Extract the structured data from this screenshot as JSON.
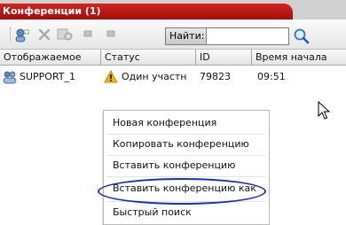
{
  "window": {
    "title": "Конференции (1)"
  },
  "toolbar": {
    "buttons": [
      {
        "name": "new-conference",
        "icon": "people-add-icon"
      },
      {
        "name": "delete",
        "icon": "delete-x-icon"
      },
      {
        "name": "properties",
        "icon": "settings-icon"
      },
      {
        "name": "start",
        "icon": "start-icon"
      },
      {
        "name": "stop",
        "icon": "stop-icon"
      }
    ],
    "find_label": "Найти:",
    "find_value": "",
    "search_icon": "magnifier-icon"
  },
  "table": {
    "columns": [
      "Отображаемое",
      "Статус",
      "ID",
      "Время начала"
    ],
    "rows": [
      {
        "display_name": "SUPPORT_1",
        "status": "Один участн",
        "status_icon": "warning-icon",
        "id": "79823",
        "start_time": "09:51"
      }
    ]
  },
  "context_menu": {
    "items": [
      "Новая конференция",
      "Копировать конференцию",
      "Вставить конференцию",
      "Вставить конференцию как",
      "Быстрый поиск"
    ],
    "highlighted_index": 3
  },
  "colors": {
    "title_bar": "#c21a15",
    "highlight_ellipse": "#1d2bc7",
    "warning": "#f2b400"
  }
}
